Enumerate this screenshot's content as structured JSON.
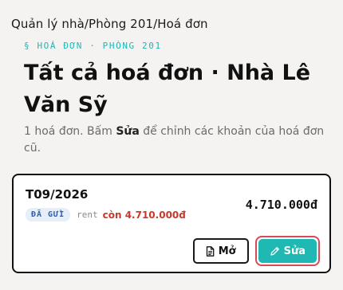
{
  "breadcrumb": "Quản lý nhà/Phòng 201/Hoá đơn",
  "eyebrow": "§ HOÁ ĐƠN · PHÒNG 201",
  "title": "Tất cả hoá đơn · Nhà Lê Văn Sỹ",
  "description": {
    "before": "1 hoá đơn. Bấm ",
    "emphasis": "Sửa",
    "after": " để chỉnh các khoản của hoá đơn cũ."
  },
  "invoice": {
    "period": "T09/2026",
    "status_badge": "ĐÃ GỬI",
    "meta_key": "rent",
    "remaining": "còn 4.710.000đ",
    "total": "4.710.000đ",
    "open_label": "Mở",
    "edit_label": "Sửa"
  },
  "icons": {
    "open": "document-icon",
    "edit": "pencil-icon"
  },
  "colors": {
    "accent": "#1fb8b2",
    "remaining": "#c8392b",
    "badge_text": "#2f5fb0",
    "focus_ring": "#d84a55"
  }
}
